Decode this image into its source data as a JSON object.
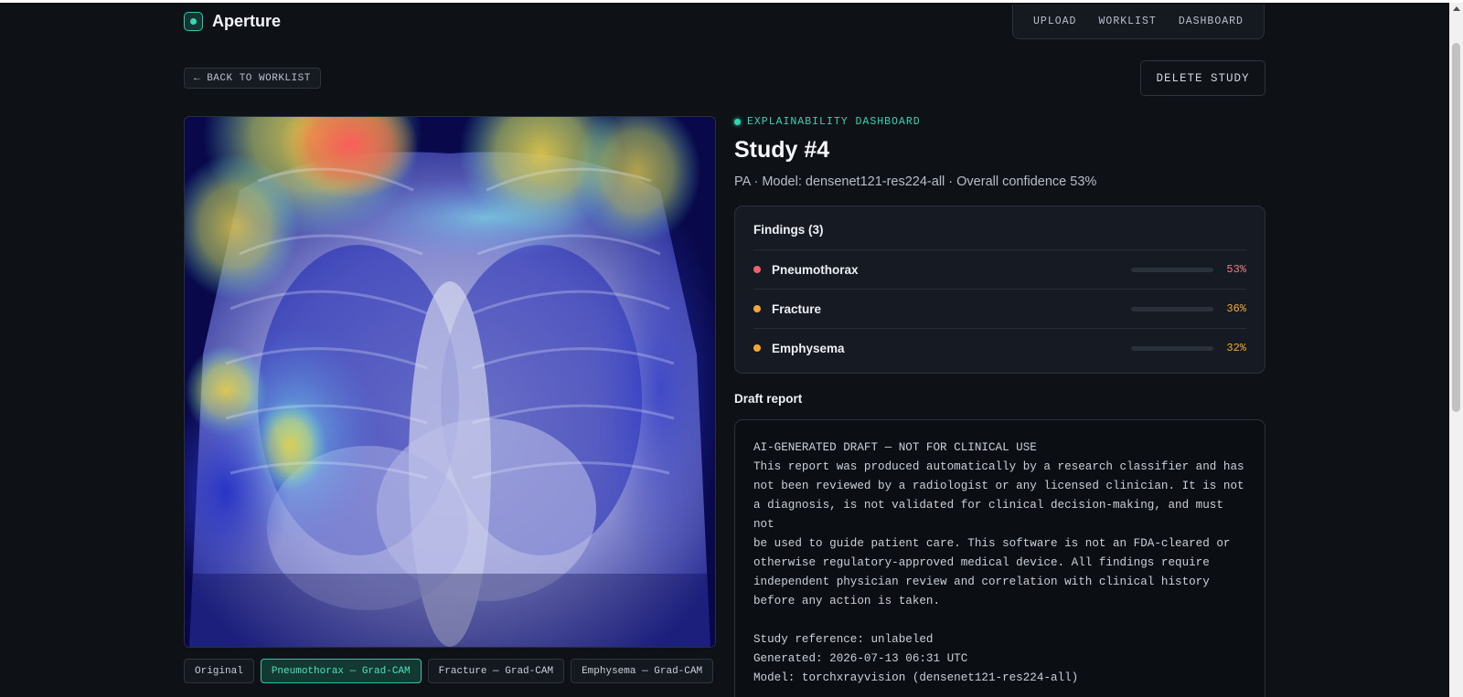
{
  "app": {
    "name": "Aperture"
  },
  "nav": {
    "items": [
      "UPLOAD",
      "WORKLIST",
      "DASHBOARD"
    ]
  },
  "actions": {
    "back_label": "← BACK TO WORKLIST",
    "delete_label": "DELETE STUDY"
  },
  "viewer": {
    "tabs": [
      {
        "label": "Original",
        "active": false
      },
      {
        "label": "Pneumothorax — Grad-CAM",
        "active": true
      },
      {
        "label": "Fracture — Grad-CAM",
        "active": false
      },
      {
        "label": "Emphysema — Grad-CAM",
        "active": false
      }
    ]
  },
  "study": {
    "eyebrow": "EXPLAINABILITY DASHBOARD",
    "title": "Study #4",
    "meta": "PA · Model: densenet121-res224-all · Overall confidence 53%"
  },
  "findings": {
    "title": "Findings (3)",
    "items": [
      {
        "name": "Pneumothorax",
        "value": 0.53,
        "pct": "53%",
        "color": "#f0616b",
        "bar_color": "#f47a82"
      },
      {
        "name": "Fracture",
        "value": 0.36,
        "pct": "36%",
        "color": "#f3a736",
        "bar_color": "#f3a736"
      },
      {
        "name": "Emphysema",
        "value": 0.32,
        "pct": "32%",
        "color": "#f3a736",
        "bar_color": "#f3a736"
      }
    ]
  },
  "report": {
    "title": "Draft report",
    "text": "AI-GENERATED DRAFT — NOT FOR CLINICAL USE\nThis report was produced automatically by a research classifier and has\nnot been reviewed by a radiologist or any licensed clinician. It is not\na diagnosis, is not validated for clinical decision-making, and must not\nbe used to guide patient care. This software is not an FDA-cleared or\notherwise regulatory-approved medical device. All findings require\nindependent physician review and correlation with clinical history\nbefore any action is taken.\n\nStudy reference: unlabeled\nGenerated: 2026-07-13 06:31 UTC\nModel: torchxrayvision (densenet121-res224-all)"
  },
  "colors": {
    "accent": "#36d3b2",
    "background": "#0e1217"
  }
}
